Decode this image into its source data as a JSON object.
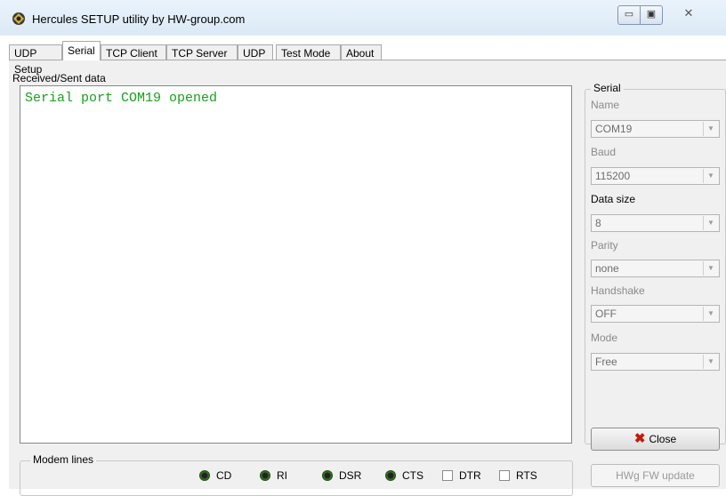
{
  "window": {
    "title": "Hercules SETUP utility by HW-group.com",
    "controls": {
      "minimize": "▭",
      "maximize": "▣",
      "close": "✕"
    }
  },
  "tabs": [
    {
      "label": "UDP Setup"
    },
    {
      "label": "Serial"
    },
    {
      "label": "TCP Client"
    },
    {
      "label": "TCP Server"
    },
    {
      "label": "UDP"
    },
    {
      "label": "Test Mode"
    },
    {
      "label": "About"
    }
  ],
  "active_tab": "Serial",
  "received": {
    "label": "Received/Sent data",
    "text": "Serial port COM19 opened",
    "text_color": "#16a11b"
  },
  "modem_lines": {
    "legend": "Modem lines",
    "leds": [
      {
        "label": "CD"
      },
      {
        "label": "RI"
      },
      {
        "label": "DSR"
      },
      {
        "label": "CTS"
      }
    ],
    "checkboxes": [
      {
        "label": "DTR",
        "checked": false
      },
      {
        "label": "RTS",
        "checked": false
      }
    ]
  },
  "serial": {
    "legend": "Serial",
    "fields": [
      {
        "label": "Name",
        "value": "COM19"
      },
      {
        "label": "Baud",
        "value": "115200"
      },
      {
        "label": "Data size",
        "value": "8"
      },
      {
        "label": "Parity",
        "value": "none"
      },
      {
        "label": "Handshake",
        "value": "OFF"
      },
      {
        "label": "Mode",
        "value": "Free"
      }
    ],
    "close_button": "Close",
    "fw_update_button": "HWg FW update"
  }
}
